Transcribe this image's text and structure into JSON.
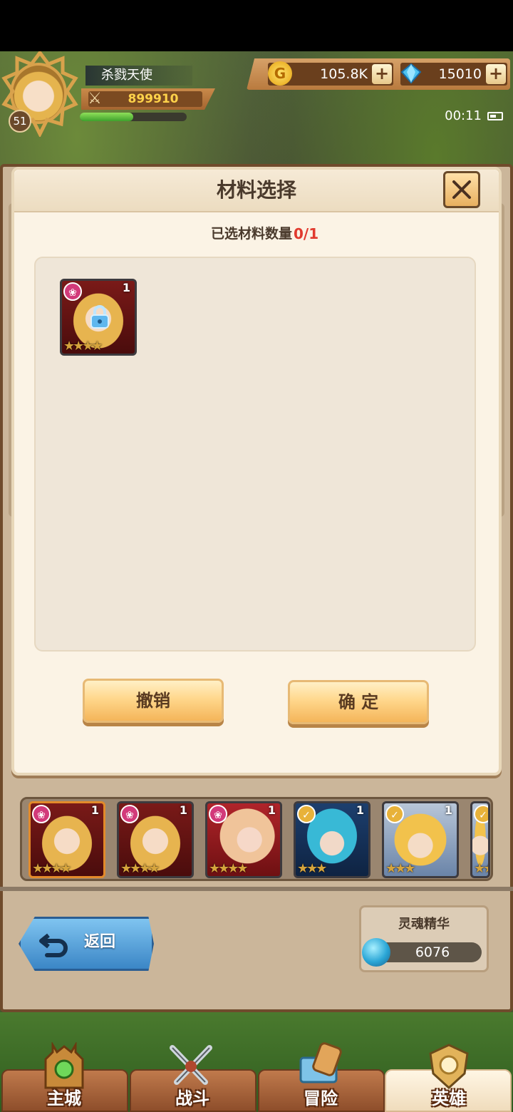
{
  "hud": {
    "player_name": "杀戮天使",
    "level": "51",
    "power": "899910",
    "exp_fraction": 0.5,
    "gold": "105.8K",
    "gems": "15010",
    "clock": "00:11"
  },
  "dialog": {
    "title": "材料选择",
    "selected_count_label": "已选材料数量",
    "selected_count_value": "0/1",
    "materials": [
      {
        "qty": "1",
        "stars": "★★★★",
        "faction": "pink",
        "locked": true,
        "portrait": "blonde"
      }
    ],
    "cancel_label": "撤销",
    "confirm_label": "确 定"
  },
  "hero_strip": [
    {
      "qty": "1",
      "stars": "★★★★",
      "faction": "pink",
      "portrait": "blonde",
      "highlight": true
    },
    {
      "qty": "1",
      "stars": "★★★★",
      "faction": "pink",
      "portrait": "blonde"
    },
    {
      "qty": "1",
      "stars": "★★★★",
      "faction": "pink",
      "portrait": "pink"
    },
    {
      "qty": "1",
      "stars": "★★★",
      "faction": "gold",
      "portrait": "teal"
    },
    {
      "qty": "1",
      "stars": "★★★",
      "faction": "gold",
      "portrait": "gold"
    },
    {
      "qty": "",
      "stars": "★★",
      "faction": "gold",
      "portrait": "gold"
    }
  ],
  "footer": {
    "back_label": "返回",
    "soul_label": "灵魂精华",
    "soul_value": "6076"
  },
  "nav": {
    "tabs": [
      {
        "label": "主城",
        "icon": "castle-icon"
      },
      {
        "label": "战斗",
        "icon": "crossed-swords-icon"
      },
      {
        "label": "冒险",
        "icon": "scroll-map-icon"
      },
      {
        "label": "英雄",
        "icon": "hero-crest-icon",
        "active": true
      }
    ]
  },
  "colors": {
    "accent_red": "#e13a2e",
    "button_gold": "#ffd78c",
    "back_blue": "#3b86c6"
  }
}
